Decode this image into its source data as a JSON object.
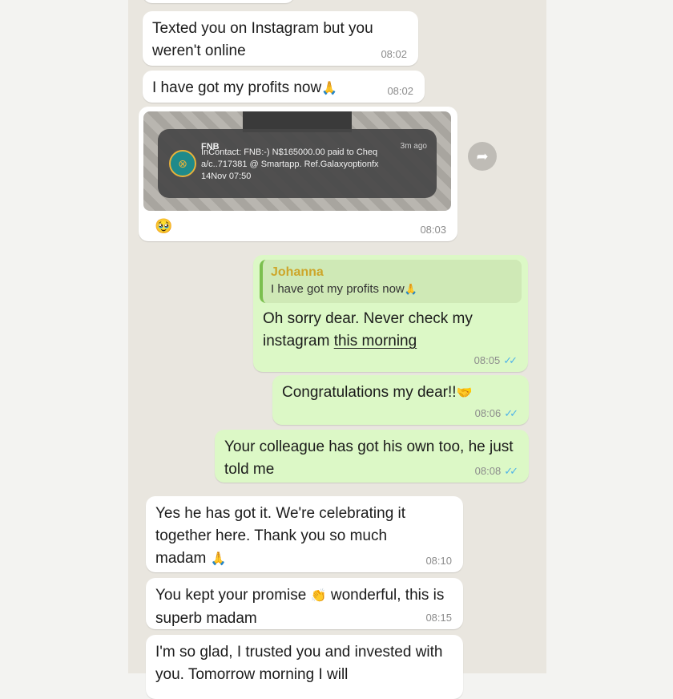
{
  "messages": [
    {
      "id": "m1",
      "dir": "in",
      "text": "Texted you on Instagram but you weren't online",
      "time": "08:02"
    },
    {
      "id": "m2",
      "dir": "in",
      "text": "I have got my profits now",
      "emoji": "🙏",
      "time": "08:02"
    },
    {
      "id": "m3",
      "dir": "in",
      "type": "image",
      "caption_emoji": "🥹",
      "time": "08:03",
      "notification": {
        "app": "FNB",
        "age": "3m ago",
        "line1": "InContact: FNB:-) N$165000.00 paid to Cheq",
        "line2": "a/c..717381 @ Smartapp. Ref.Galaxyoptionfx",
        "line3": "14Nov 07:50"
      }
    },
    {
      "id": "m4",
      "dir": "out",
      "quote": {
        "author": "Johanna",
        "text": "I have got my profits now",
        "emoji": "🙏"
      },
      "text_line1": "Oh sorry dear. Never check my",
      "text_line2_a": "instagram ",
      "text_line2_b": "this morning",
      "time": "08:05"
    },
    {
      "id": "m5",
      "dir": "out",
      "text": "Congratulations my dear!!",
      "emoji": "🤝",
      "time": "08:06"
    },
    {
      "id": "m6",
      "dir": "out",
      "text": "Your colleague has got his own too, he just told me",
      "time": "08:08"
    },
    {
      "id": "m7",
      "dir": "in",
      "text": "Yes he has got it. We're celebrating it together here. Thank you so much madam",
      "emoji": "🙏",
      "time": "08:10"
    },
    {
      "id": "m8",
      "dir": "in",
      "text_a": "You kept your promise",
      "emoji": "👏",
      "text_b": "wonderful, this is superb madam",
      "time": "08:15"
    },
    {
      "id": "m9",
      "dir": "in",
      "text": "I'm so glad, I trusted you and invested with you. Tomorrow morning I will"
    }
  ],
  "icons": {
    "forward": "forward-icon",
    "read_receipt": "double-check-icon"
  }
}
